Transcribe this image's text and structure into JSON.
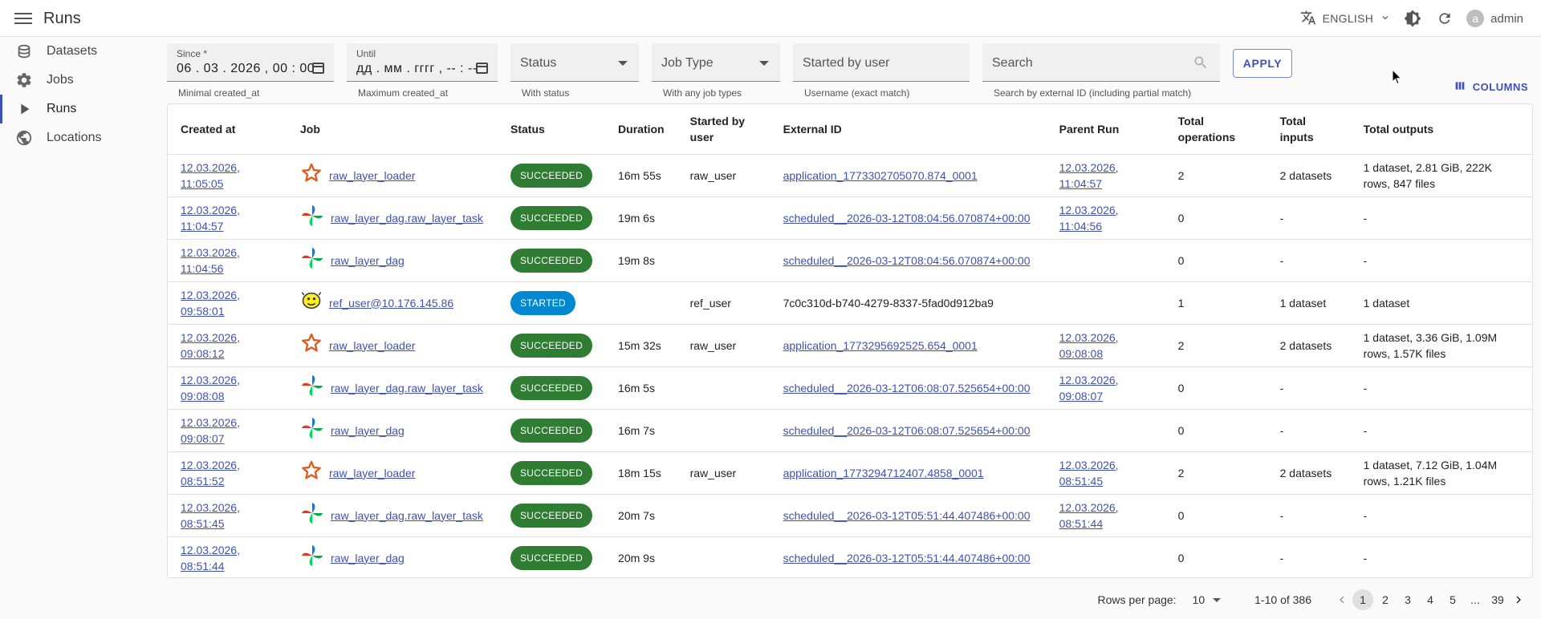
{
  "header": {
    "title": "Runs",
    "language": "ENGLISH",
    "user": "admin",
    "avatar_letter": "a"
  },
  "sidebar": {
    "items": [
      {
        "label": "Datasets",
        "icon": "database-icon"
      },
      {
        "label": "Jobs",
        "icon": "gear-icon"
      },
      {
        "label": "Runs",
        "icon": "play-icon",
        "active": true
      },
      {
        "label": "Locations",
        "icon": "globe-icon"
      }
    ]
  },
  "filters": {
    "since": {
      "label": "Since *",
      "value": "06 . 03 . 2026 ,  00 : 00",
      "helper": "Minimal created_at"
    },
    "until": {
      "label": "Until",
      "value": "дд . мм . гггг ,  -- : --",
      "helper": "Maximum created_at"
    },
    "status": {
      "placeholder": "Status",
      "helper": "With status"
    },
    "job_type": {
      "placeholder": "Job Type",
      "helper": "With any job types"
    },
    "started_by": {
      "placeholder": "Started by user",
      "helper": "Username (exact match)"
    },
    "search": {
      "placeholder": "Search",
      "helper": "Search by external ID (including partial match)"
    },
    "apply_label": "APPLY",
    "columns_label": "COLUMNS"
  },
  "table": {
    "columns": [
      "Created at",
      "Job",
      "Status",
      "Duration",
      "Started by user",
      "External ID",
      "Parent Run",
      "Total operations",
      "Total inputs",
      "Total outputs"
    ],
    "rows": [
      {
        "created": "12.03.2026, 11:05:05",
        "job": "raw_layer_loader",
        "job_icon": "spark-icon",
        "status": "SUCCEEDED",
        "duration": "16m 55s",
        "started_by": "raw_user",
        "external_id": "application_1773302705070.874_0001",
        "external_link": true,
        "parent": "12.03.2026, 11:04:57",
        "ops": "2",
        "inputs": "2 datasets",
        "outputs": "1 dataset, 2.81 GiB, 222K rows, 847 files"
      },
      {
        "created": "12.03.2026, 11:04:57",
        "job": "raw_layer_dag.raw_layer_task",
        "job_icon": "airflow-icon",
        "status": "SUCCEEDED",
        "duration": "19m 6s",
        "started_by": "",
        "external_id": "scheduled__2026-03-12T08:04:56.070874+00:00",
        "external_link": true,
        "parent": "12.03.2026, 11:04:56",
        "ops": "0",
        "inputs": "-",
        "outputs": "-"
      },
      {
        "created": "12.03.2026, 11:04:56",
        "job": "raw_layer_dag",
        "job_icon": "airflow-icon",
        "status": "SUCCEEDED",
        "duration": "19m 8s",
        "started_by": "",
        "external_id": "scheduled__2026-03-12T08:04:56.070874+00:00",
        "external_link": true,
        "parent": "",
        "ops": "0",
        "inputs": "-",
        "outputs": "-"
      },
      {
        "created": "12.03.2026, 09:58:01",
        "job": "ref_user@10.176.145.86",
        "job_icon": "hive-icon",
        "status": "STARTED",
        "duration": "",
        "started_by": "ref_user",
        "external_id": "7c0c310d-b740-4279-8337-5fad0d912ba9",
        "external_link": false,
        "parent": "",
        "ops": "1",
        "inputs": "1 dataset",
        "outputs": "1 dataset"
      },
      {
        "created": "12.03.2026, 09:08:12",
        "job": "raw_layer_loader",
        "job_icon": "spark-icon",
        "status": "SUCCEEDED",
        "duration": "15m 32s",
        "started_by": "raw_user",
        "external_id": "application_1773295692525.654_0001",
        "external_link": true,
        "parent": "12.03.2026, 09:08:08",
        "ops": "2",
        "inputs": "2 datasets",
        "outputs": "1 dataset, 3.36 GiB, 1.09M rows, 1.57K files"
      },
      {
        "created": "12.03.2026, 09:08:08",
        "job": "raw_layer_dag.raw_layer_task",
        "job_icon": "airflow-icon",
        "status": "SUCCEEDED",
        "duration": "16m 5s",
        "started_by": "",
        "external_id": "scheduled__2026-03-12T06:08:07.525654+00:00",
        "external_link": true,
        "parent": "12.03.2026, 09:08:07",
        "ops": "0",
        "inputs": "-",
        "outputs": "-"
      },
      {
        "created": "12.03.2026, 09:08:07",
        "job": "raw_layer_dag",
        "job_icon": "airflow-icon",
        "status": "SUCCEEDED",
        "duration": "16m 7s",
        "started_by": "",
        "external_id": "scheduled__2026-03-12T06:08:07.525654+00:00",
        "external_link": true,
        "parent": "",
        "ops": "0",
        "inputs": "-",
        "outputs": "-"
      },
      {
        "created": "12.03.2026, 08:51:52",
        "job": "raw_layer_loader",
        "job_icon": "spark-icon",
        "status": "SUCCEEDED",
        "duration": "18m 15s",
        "started_by": "raw_user",
        "external_id": "application_1773294712407.4858_0001",
        "external_link": true,
        "parent": "12.03.2026, 08:51:45",
        "ops": "2",
        "inputs": "2 datasets",
        "outputs": "1 dataset, 7.12 GiB, 1.04M rows, 1.21K files"
      },
      {
        "created": "12.03.2026, 08:51:45",
        "job": "raw_layer_dag.raw_layer_task",
        "job_icon": "airflow-icon",
        "status": "SUCCEEDED",
        "duration": "20m 7s",
        "started_by": "",
        "external_id": "scheduled__2026-03-12T05:51:44.407486+00:00",
        "external_link": true,
        "parent": "12.03.2026, 08:51:44",
        "ops": "0",
        "inputs": "-",
        "outputs": "-"
      },
      {
        "created": "12.03.2026, 08:51:44",
        "job": "raw_layer_dag",
        "job_icon": "airflow-icon",
        "status": "SUCCEEDED",
        "duration": "20m 9s",
        "started_by": "",
        "external_id": "scheduled__2026-03-12T05:51:44.407486+00:00",
        "external_link": true,
        "parent": "",
        "ops": "0",
        "inputs": "-",
        "outputs": "-"
      }
    ]
  },
  "pagination": {
    "rows_per_page_label": "Rows per page:",
    "rows_per_page": "10",
    "range": "1-10 of 386",
    "pages": [
      "1",
      "2",
      "3",
      "4",
      "5",
      "...",
      "39"
    ],
    "current": "1"
  },
  "colors": {
    "accent": "#3f51b5",
    "succeeded": "#2e7d32",
    "started": "#0288d1"
  }
}
